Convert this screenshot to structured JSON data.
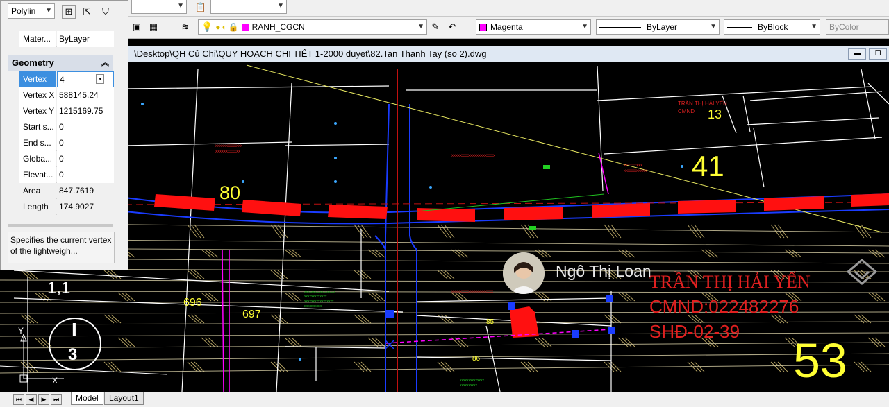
{
  "toolbar": {
    "layer_name": "RANH_CGCN",
    "color": "Magenta",
    "linetype": "ByLayer",
    "lineweight": "ByBlock",
    "plotstyle": "ByColor"
  },
  "document": {
    "path": "\\Desktop\\QH Củ Chi\\QUY HOẠCH CHI TIẾT 1-2000 duyet\\82.Tan Thanh Tay (so 2).dwg"
  },
  "properties": {
    "object_type": "Polylin",
    "material_label": "Mater...",
    "material_value": "ByLayer",
    "section_title": "Geometry",
    "rows": [
      {
        "name": "Vertex",
        "value": "4"
      },
      {
        "name": "Vertex X",
        "value": "588145.24"
      },
      {
        "name": "Vertex Y",
        "value": "1215169.75"
      },
      {
        "name": "Start s...",
        "value": "0"
      },
      {
        "name": "End s...",
        "value": "0"
      },
      {
        "name": "Globa...",
        "value": "0"
      },
      {
        "name": "Elevat...",
        "value": "0"
      },
      {
        "name": "Area",
        "value": "847.7619"
      },
      {
        "name": "Length",
        "value": "174.9027"
      }
    ],
    "description": "Specifies the current vertex of the lightweigh..."
  },
  "drawing": {
    "lot_labels": [
      "80",
      "41",
      "13",
      "53",
      "696",
      "697",
      "1,1",
      "85",
      "86",
      "I",
      "3"
    ],
    "owner_text_line1": "TRẦN THỊ HẢI YẾN",
    "owner_text_line2": "CMND:022482276",
    "owner_text_line3": "SHĐ-02-39",
    "small_owner_line1": "TRẦN THỊ HẢI YẾN",
    "small_owner_line2": "CMND",
    "axis_y": "Y",
    "axis_x": "X",
    "colors": {
      "red_band": "#ff1010",
      "lot_line": "#ffffff",
      "hatch": "#c8b46e",
      "magenta": "#ff00ff",
      "label_yellow": "#ffff33"
    }
  },
  "overlay": {
    "user_name": "Ngô Thị Loan"
  },
  "tabs": {
    "model": "Model",
    "layout": "Layout1"
  }
}
